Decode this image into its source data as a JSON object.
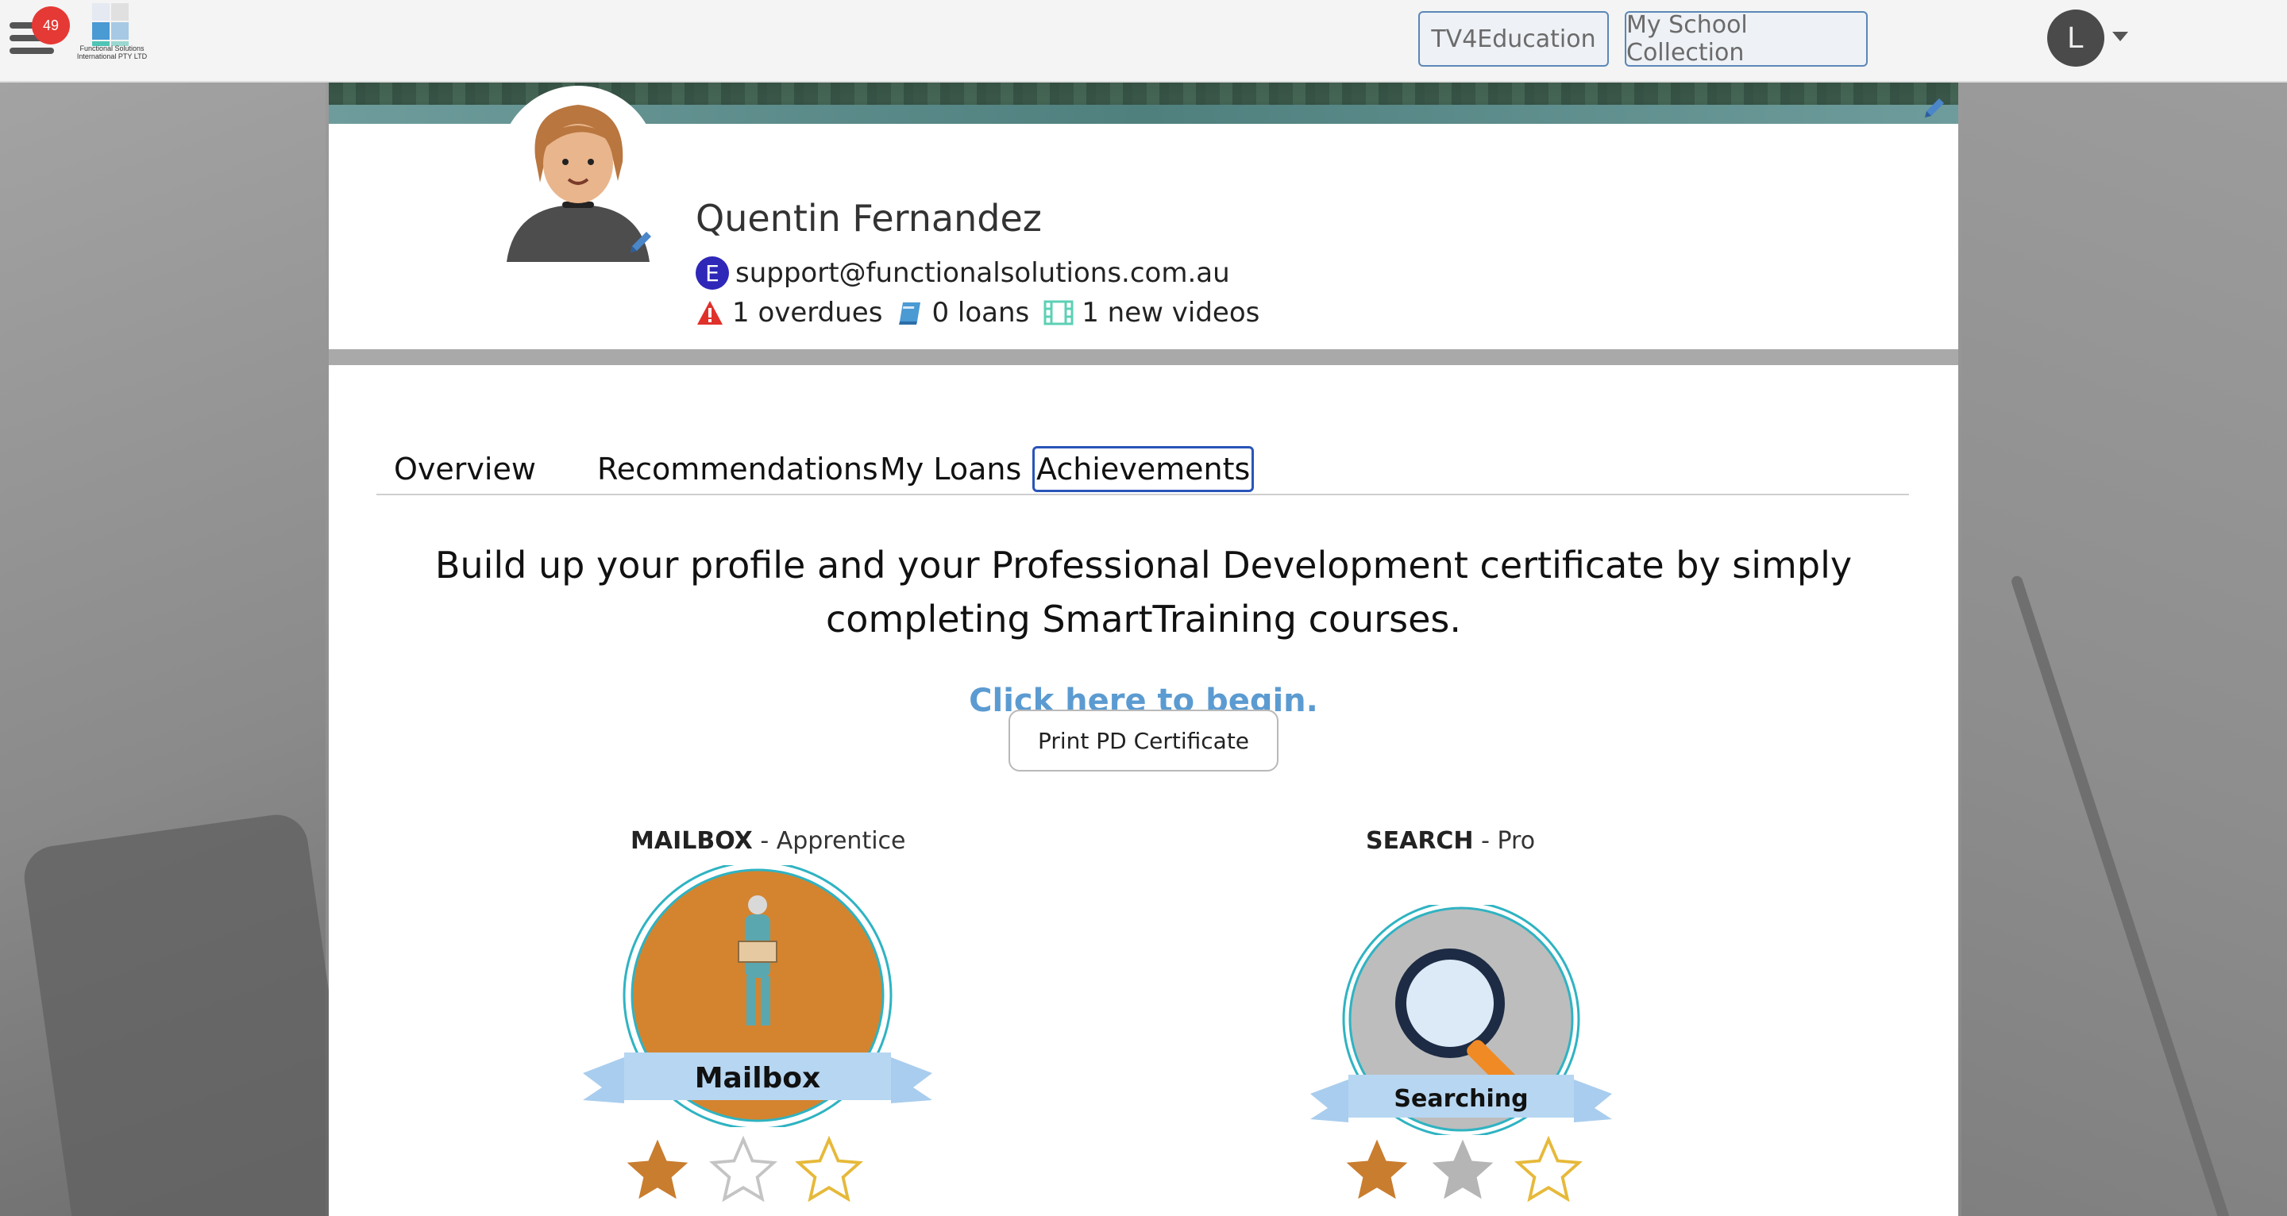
{
  "topbar": {
    "notification_count": "49",
    "logo_text": "Functional Solutions International PTY LTD",
    "buttons": [
      "TV4Education",
      "My School Collection"
    ],
    "user_initial": "L"
  },
  "profile": {
    "name": "Quentin Fernandez",
    "email_badge": "E",
    "email": "support@functionalsolutions.com.au",
    "overdues": "1 overdues",
    "loans": "0 loans",
    "new_videos": "1 new videos"
  },
  "tabs": [
    {
      "label": "Overview",
      "active": false
    },
    {
      "label": "Recommendations",
      "active": false
    },
    {
      "label": "My Loans",
      "active": false
    },
    {
      "label": "Achievements",
      "active": true
    }
  ],
  "achievements": {
    "intro": "Build up your profile and your Professional Development certificate by simply completing SmartTraining courses.",
    "begin_link": "Click here to begin.",
    "print_button": "Print PD Certificate",
    "items": [
      {
        "name": "MAILBOX",
        "level": "- Apprentice",
        "badge_label": "Mailbox",
        "stars_earned": 1,
        "stars_total": 3
      },
      {
        "name": "SEARCH",
        "level": "- Pro",
        "badge_label": "Searching",
        "stars_earned": 2,
        "stars_total": 3
      }
    ]
  },
  "colors": {
    "accent_blue": "#5b9bd1",
    "badge_red": "#e53935",
    "active_tab_border": "#2a55b8",
    "bronze": "#c97d2e",
    "silver": "#b5b5b5",
    "gold_outline": "#e6b93a"
  }
}
